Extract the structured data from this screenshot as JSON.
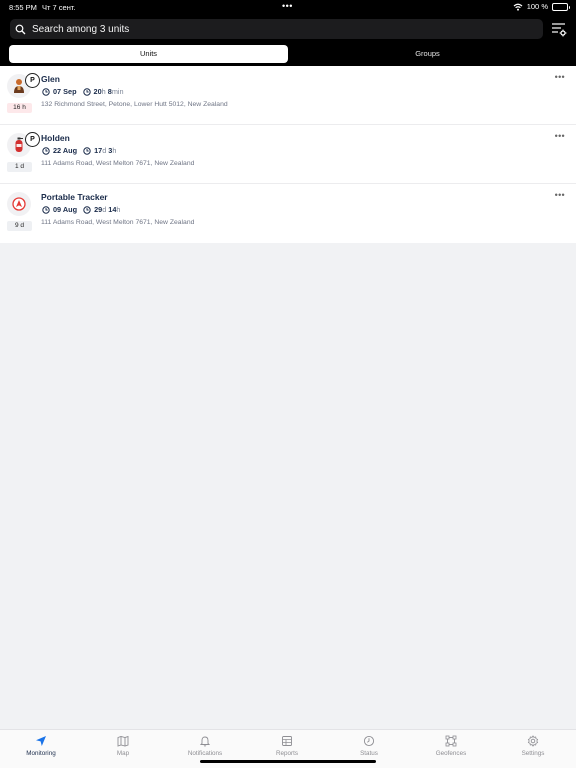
{
  "status_bar": {
    "time": "8:55 PM",
    "date": "Чт 7 сент.",
    "battery_text": "100 %"
  },
  "search": {
    "placeholder": "Search among 3 units",
    "icon": "search-icon"
  },
  "filter_icon": "filter-settings-icon",
  "segments": [
    {
      "label": "Units",
      "active": true
    },
    {
      "label": "Groups",
      "active": false
    }
  ],
  "units": [
    {
      "name": "Glen",
      "icon": "person-avatar-icon",
      "parked": true,
      "parked_label": "P",
      "age": "16 h",
      "age_warning": true,
      "date_value": "07 Sep",
      "duration_1_num": "20",
      "duration_1_unit": "h",
      "duration_2_num": "8",
      "duration_2_unit": "min",
      "address": "132 Richmond Street, Petone, Lower Hutt 5012, New Zealand"
    },
    {
      "name": "Holden",
      "icon": "fire-extinguisher-icon",
      "parked": true,
      "parked_label": "P",
      "age": "1 d",
      "age_warning": false,
      "date_value": "22 Aug",
      "duration_1_num": "17",
      "duration_1_unit": "d",
      "duration_2_num": "3",
      "duration_2_unit": "h",
      "address": "111 Adams Road, West Melton 7671, New Zealand"
    },
    {
      "name": "Portable Tracker",
      "icon": "navigation-arrow-icon",
      "parked": false,
      "parked_label": "",
      "age": "9 d",
      "age_warning": false,
      "date_value": "09 Aug",
      "duration_1_num": "29",
      "duration_1_unit": "d",
      "duration_2_num": "14",
      "duration_2_unit": "h",
      "address": "111 Adams Road, West Melton 7671, New Zealand"
    }
  ],
  "tabs": [
    {
      "label": "Monitoring",
      "icon": "navigation-arrow-icon",
      "active": true
    },
    {
      "label": "Map",
      "icon": "map-icon",
      "active": false
    },
    {
      "label": "Notifications",
      "icon": "bell-icon",
      "active": false
    },
    {
      "label": "Reports",
      "icon": "report-icon",
      "active": false
    },
    {
      "label": "Status",
      "icon": "clock-icon",
      "active": false
    },
    {
      "label": "Geofences",
      "icon": "geofence-icon",
      "active": false
    },
    {
      "label": "Settings",
      "icon": "gear-icon",
      "active": false
    }
  ],
  "colors": {
    "accent": "#1a73e8",
    "primary_text": "#1a2b4a",
    "warning_badge": "#fde8ea"
  }
}
